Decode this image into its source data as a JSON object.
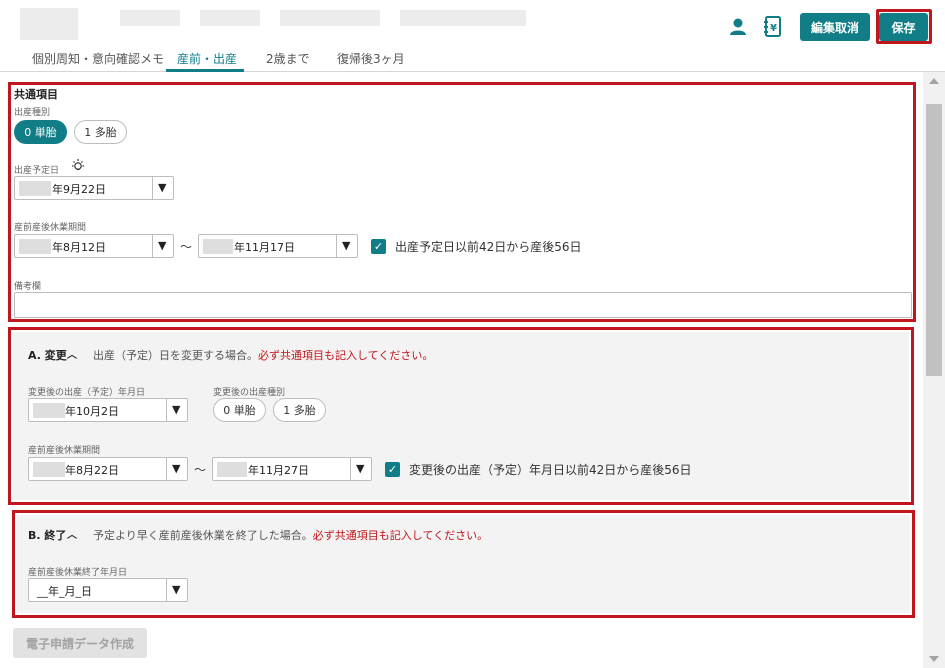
{
  "header": {
    "cancel_edit_label": "編集取消",
    "save_label": "保存",
    "user_icon": "person-icon",
    "document_icon": "yen-document-icon"
  },
  "tabs": [
    {
      "label": "個別周知・意向確認メモ"
    },
    {
      "label": "産前・出産"
    },
    {
      "label": "2歳まで"
    },
    {
      "label": "復帰後3ヶ月"
    }
  ],
  "common": {
    "title": "共通項目",
    "birth_type_label": "出産種別",
    "birth_type_options": [
      "0 単胎",
      "1 多胎"
    ],
    "due_date_label": "出産予定日",
    "due_date_value": "年9月22日",
    "leave_period_label": "産前産後休業期間",
    "leave_start": "年8月12日",
    "leave_end": "年11月17日",
    "leave_checkbox_label": "出産予定日以前42日から産後56日",
    "remarks_label": "備考欄"
  },
  "section_a": {
    "title": "A. 変更",
    "note": "出産（予定）日を変更する場合。",
    "note_emphasis": "必ず共通項目も記入してください。",
    "changed_date_label": "変更後の出産（予定）年月日",
    "changed_date_value": "年10月2日",
    "changed_type_label": "変更後の出産種別",
    "changed_type_options": [
      "0 単胎",
      "1 多胎"
    ],
    "leave_period_label": "産前産後休業期間",
    "leave_start": "年8月22日",
    "leave_end": "年11月27日",
    "leave_checkbox_label": "変更後の出産（予定）年月日以前42日から産後56日"
  },
  "section_b": {
    "title": "B. 終了",
    "note": "予定より早く産前産後休業を終了した場合。",
    "note_emphasis": "必ず共通項目も記入してください。",
    "end_date_label": "産前産後休業終了年月日",
    "end_date_value": "__年_月_日"
  },
  "footer": {
    "create_data_label": "電子申請データ作成"
  },
  "colors": {
    "accent": "#117e87",
    "highlight": "#c0161d",
    "warning_text": "#c0161d"
  }
}
